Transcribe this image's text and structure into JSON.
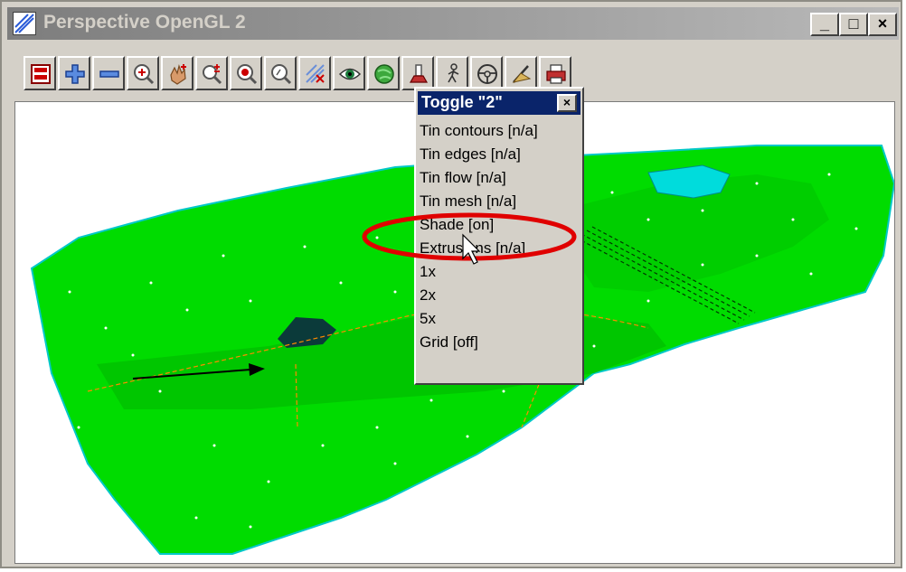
{
  "window": {
    "title": "Perspective OpenGL 2",
    "controls": {
      "minimize": "_",
      "maximize": "□",
      "close": "×"
    }
  },
  "toolbar": {
    "buttons": [
      {
        "icon": "plot-window-icon"
      },
      {
        "icon": "zoom-in-plus-icon"
      },
      {
        "icon": "zoom-out-minus-icon"
      },
      {
        "icon": "zoom-magnifier-icon"
      },
      {
        "icon": "pan-hand-icon"
      },
      {
        "icon": "zoom-in-out-icon"
      },
      {
        "icon": "zoom-extents-icon"
      },
      {
        "icon": "search-icon"
      },
      {
        "icon": "toggle-icon"
      },
      {
        "icon": "eye-icon"
      },
      {
        "icon": "globe-icon"
      },
      {
        "icon": "light-icon"
      },
      {
        "icon": "walk-icon"
      },
      {
        "icon": "steering-wheel-icon"
      },
      {
        "icon": "drape-icon"
      },
      {
        "icon": "print-icon"
      }
    ]
  },
  "popup": {
    "title": "Toggle \"2\"",
    "close": "×",
    "items": [
      "Tin contours [n/a]",
      "Tin edges [n/a]",
      "Tin flow [n/a]",
      "Tin mesh [n/a]",
      "Shade [on]",
      "Extrusions [n/a]",
      "1x",
      "2x",
      "5x",
      "Grid [off]"
    ],
    "highlighted_item": "Shade [on]"
  },
  "colors": {
    "terrain": "#00dc00",
    "terrain_dark": "#00b400",
    "water": "#00dcdc",
    "hole": "#0b3a3a",
    "highlight_ellipse": "#e00000",
    "popup_title_bg": "#0a246a"
  }
}
